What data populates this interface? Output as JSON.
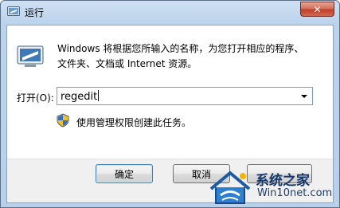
{
  "window": {
    "title": "运行",
    "close_icon": "close-icon"
  },
  "dialog": {
    "run_icon": "run-dialog-icon",
    "description": "Windows 将根据您所输入的名称，为您打开相应的程序、文件夹、文档或 Internet 资源。",
    "open_label": "打开(O):",
    "open_value": "regedit",
    "dropdown_icon": "chevron-down-icon",
    "shield_icon": "uac-shield-icon",
    "admin_note": "使用管理权限创建此任务。"
  },
  "buttons": {
    "ok": "确定",
    "cancel": "取消",
    "browse": ""
  },
  "watermark": {
    "title": "系统之家",
    "subtitle": "Win10net.com"
  },
  "colors": {
    "title_gradient_top": "#cfe0f3",
    "title_gradient_bottom": "#b9d0ea",
    "close_button": "#c0402a",
    "footer_background": "#f0f0f0",
    "input_border": "#7a9bc4",
    "default_button_border": "#3c7fb1"
  }
}
